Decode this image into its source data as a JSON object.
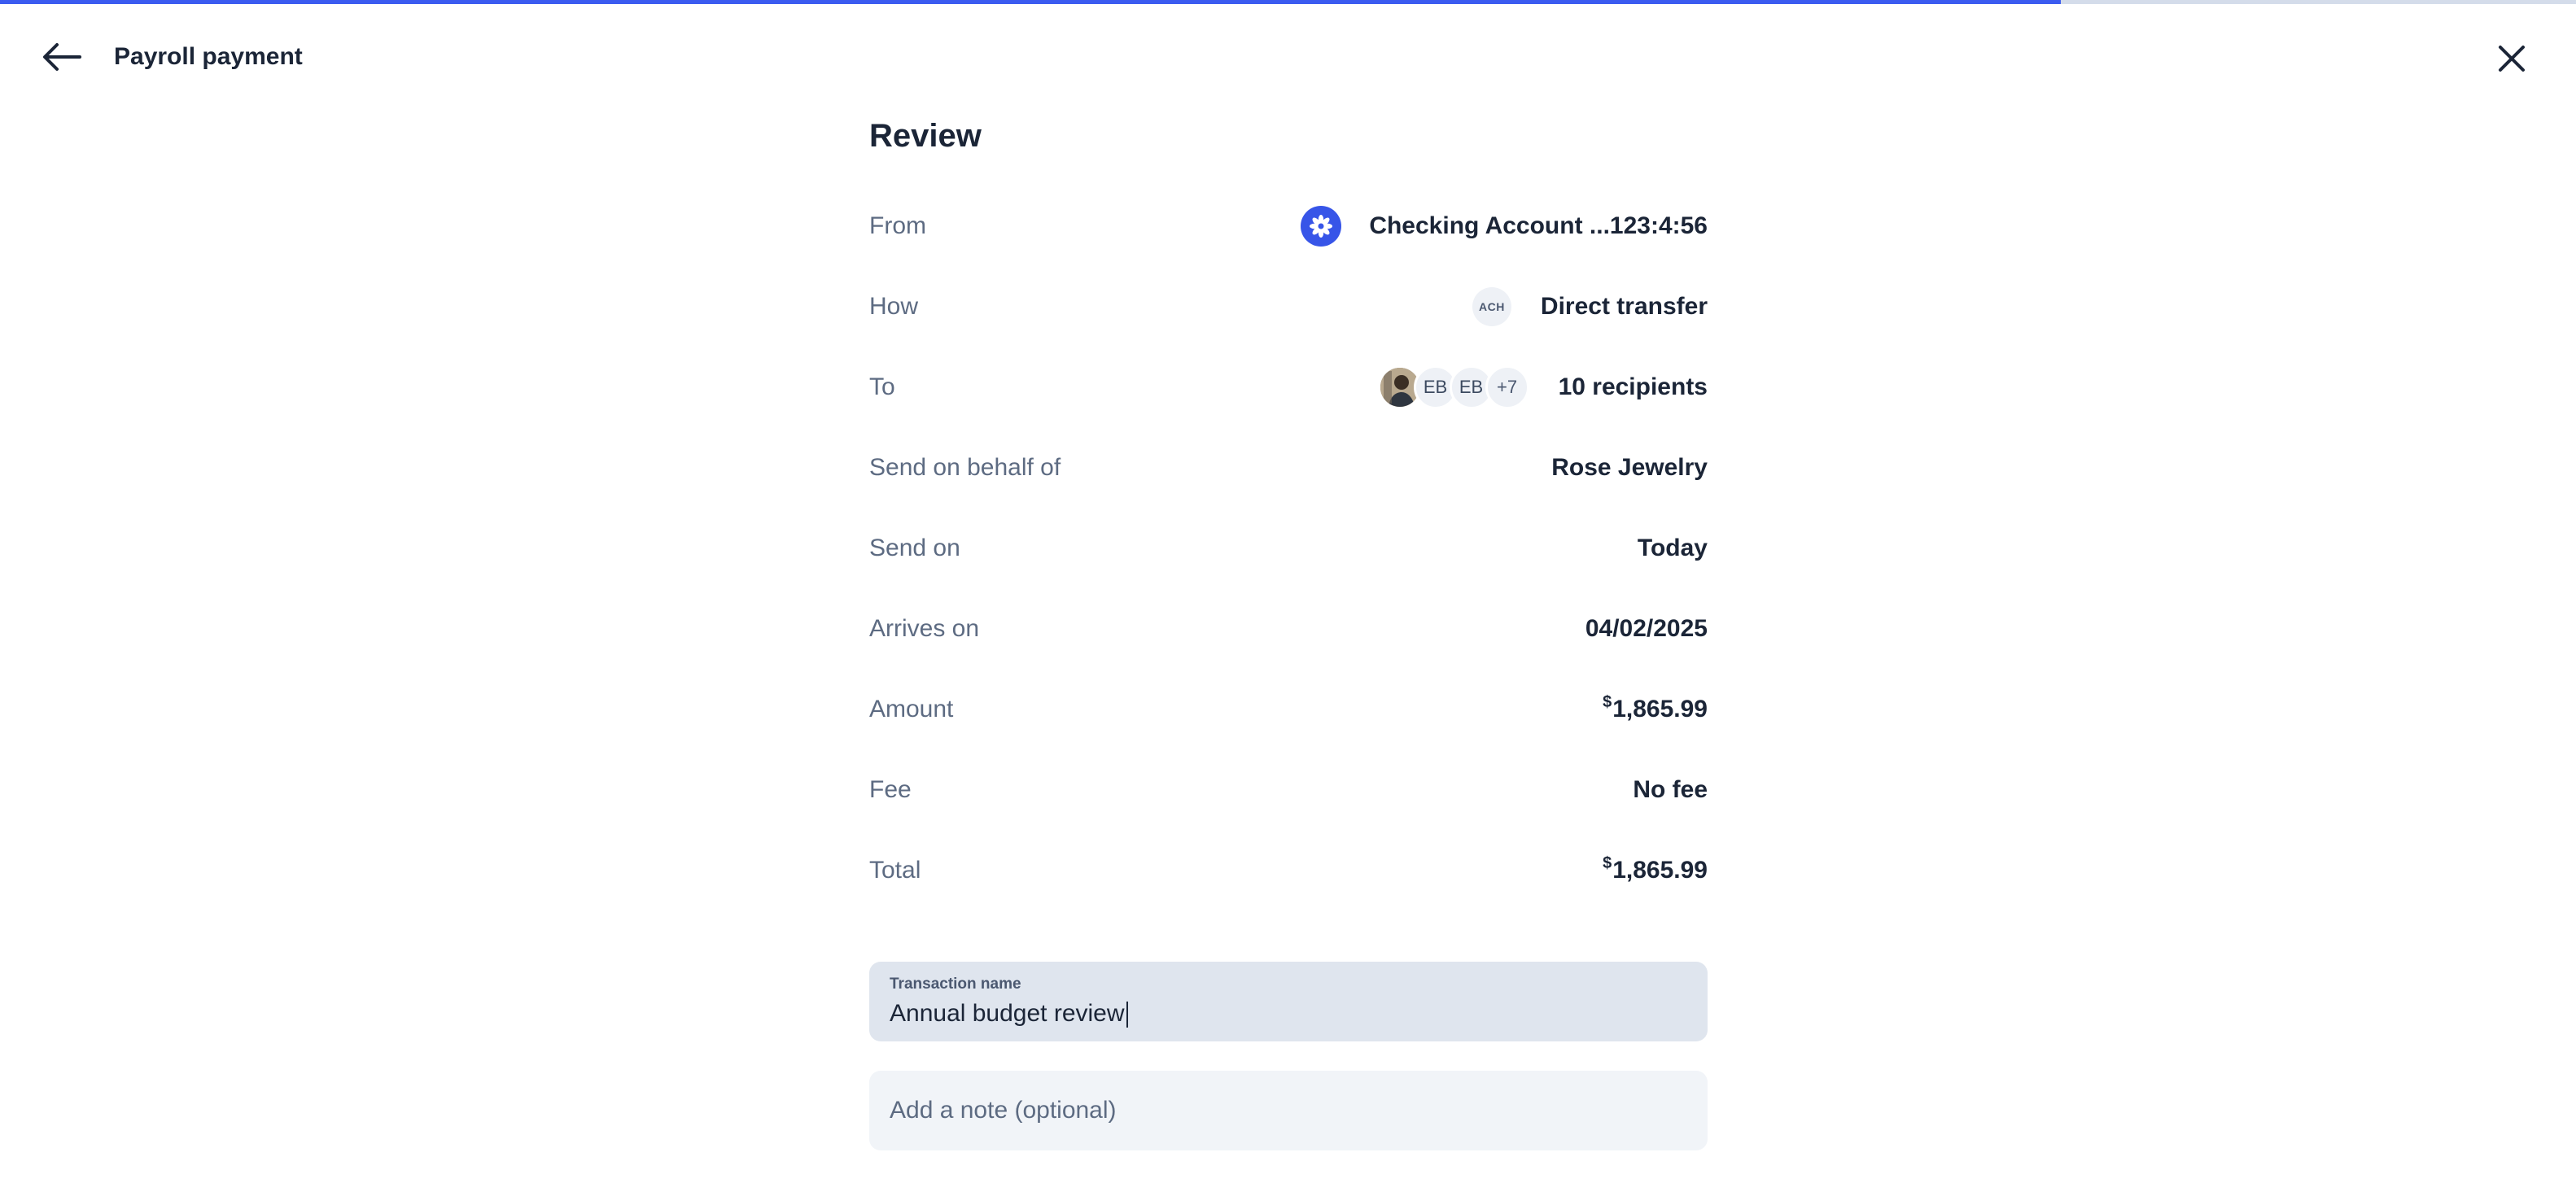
{
  "header": {
    "title": "Payroll payment",
    "progress_percent": 80
  },
  "review": {
    "title": "Review",
    "rows": [
      {
        "label": "From",
        "value": "Checking Account ...123:4:56",
        "icon": "bank-flower-icon"
      },
      {
        "label": "How",
        "value": "Direct transfer",
        "badge": "ACH"
      },
      {
        "label": "To",
        "value": "10 recipients",
        "avatars": [
          "photo",
          "EB",
          "EB",
          "+7"
        ]
      },
      {
        "label": "Send on behalf of",
        "value": "Rose Jewelry"
      },
      {
        "label": "Send on",
        "value": "Today"
      },
      {
        "label": "Arrives on",
        "value": "04/02/2025"
      },
      {
        "label": "Amount",
        "currency_symbol": "$",
        "value": "1,865.99"
      },
      {
        "label": "Fee",
        "value": "No fee"
      },
      {
        "label": "Total",
        "currency_symbol": "$",
        "value": "1,865.99"
      }
    ]
  },
  "transaction_name": {
    "label": "Transaction name",
    "value": "Annual budget review"
  },
  "note": {
    "placeholder": "Add a note (optional)"
  },
  "colors": {
    "accent": "#3b5bf0",
    "text": "#1b2537",
    "muted": "#5d6b82"
  }
}
